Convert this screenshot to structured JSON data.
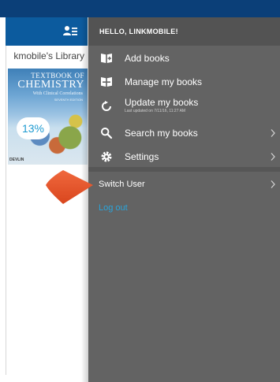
{
  "library": {
    "title": "kmobile's Library",
    "book": {
      "title_line1": "TEXTBOOK OF",
      "title_line2": "CHEMISTRY",
      "subtitle": "With Clinical Correlations",
      "edition": "SEVENTH EDITION",
      "author": "DEVLIN",
      "progress": "13%",
      "progress_value": 0.13
    }
  },
  "drawer": {
    "greeting": "HELLO, LINKMOBILE!",
    "items": [
      {
        "label": "Add books",
        "icon": "add-book-icon"
      },
      {
        "label": "Manage my books",
        "icon": "manage-books-icon"
      },
      {
        "label": "Update my books",
        "sub": "Last updated on 7/11/16, 11:27 AM",
        "icon": "refresh-icon"
      },
      {
        "label": "Search my books",
        "icon": "search-icon"
      },
      {
        "label": "Settings",
        "icon": "gear-icon"
      }
    ],
    "switch_user": "Switch User",
    "logout": "Log out"
  },
  "colors": {
    "topbar": "#0b3f78",
    "header": "#0c5b9e",
    "drawer": "#636363",
    "accent": "#29a5dc",
    "pointer": "#e8542b"
  }
}
